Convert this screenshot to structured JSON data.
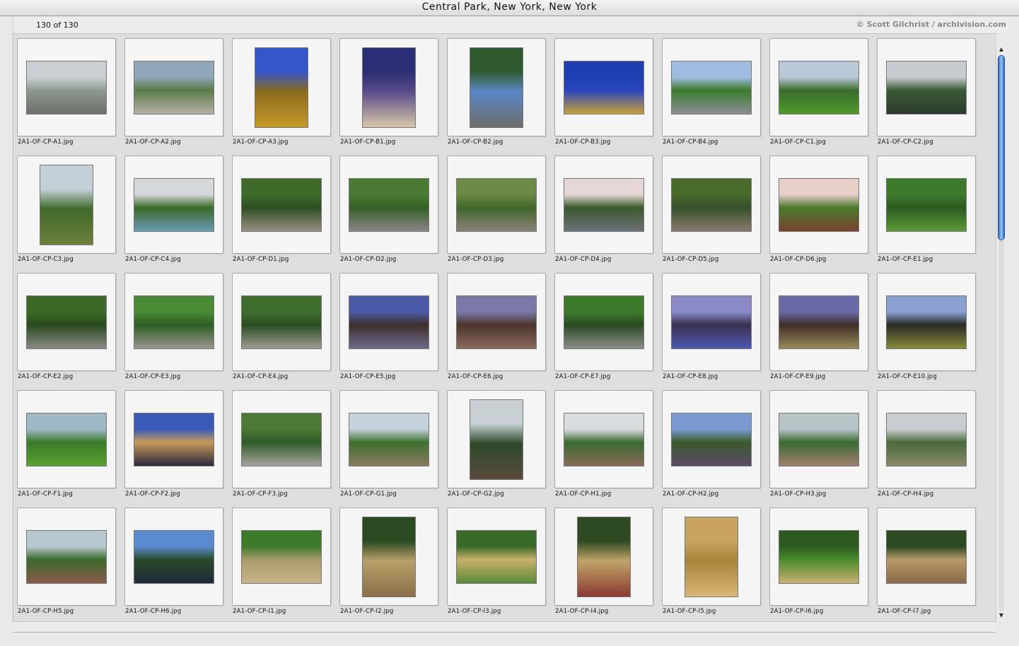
{
  "window": {
    "title": "Central Park, New York, New York"
  },
  "info": {
    "count": "130 of 130",
    "credit": "© Scott Gilchrist / archivision.com"
  },
  "colors": {
    "scroll_accent": "#2f6fc9"
  },
  "slides": [
    {
      "file": "2A1-OF-CP-A1.jpg",
      "orientation": "landscape",
      "palette": [
        "#c9cfd3",
        "#8e9a8f",
        "#6d6f6a"
      ]
    },
    {
      "file": "2A1-OF-CP-A2.jpg",
      "orientation": "landscape",
      "palette": [
        "#8fa7b8",
        "#5a7a4a",
        "#b8b2a6"
      ]
    },
    {
      "file": "2A1-OF-CP-A3.jpg",
      "orientation": "portrait",
      "palette": [
        "#3556c8",
        "#8a6a1c",
        "#c79a2a"
      ]
    },
    {
      "file": "2A1-OF-CP-B1.jpg",
      "orientation": "portrait",
      "palette": [
        "#2a2e74",
        "#5a4a8a",
        "#d8c8a8"
      ]
    },
    {
      "file": "2A1-OF-CP-B2.jpg",
      "orientation": "portrait",
      "palette": [
        "#2f5a2f",
        "#5a87c4",
        "#6d6d6d"
      ]
    },
    {
      "file": "2A1-OF-CP-B3.jpg",
      "orientation": "landscape",
      "palette": [
        "#1f3fb0",
        "#2845c0",
        "#c9a13a"
      ]
    },
    {
      "file": "2A1-OF-CP-B4.jpg",
      "orientation": "landscape",
      "palette": [
        "#9fbde0",
        "#3c7a2c",
        "#8a8f94"
      ]
    },
    {
      "file": "2A1-OF-CP-C1.jpg",
      "orientation": "landscape",
      "palette": [
        "#b9c8d6",
        "#3b6b2b",
        "#4f9a2c"
      ]
    },
    {
      "file": "2A1-OF-CP-C2.jpg",
      "orientation": "landscape",
      "palette": [
        "#c8ccd0",
        "#3a5a34",
        "#2b3a2c"
      ]
    },
    {
      "file": "2A1-OF-CP-C3.jpg",
      "orientation": "portrait",
      "palette": [
        "#c4d0d8",
        "#3f6a2a",
        "#6e7f3a"
      ]
    },
    {
      "file": "2A1-OF-CP-C4.jpg",
      "orientation": "landscape",
      "palette": [
        "#d4d8da",
        "#3a6a2a",
        "#6a9ab0"
      ]
    },
    {
      "file": "2A1-OF-CP-D1.jpg",
      "orientation": "landscape",
      "palette": [
        "#3f6a2a",
        "#2e4e22",
        "#9a8f86"
      ]
    },
    {
      "file": "2A1-OF-CP-D2.jpg",
      "orientation": "landscape",
      "palette": [
        "#4a7a32",
        "#35602a",
        "#8a8482"
      ]
    },
    {
      "file": "2A1-OF-CP-D3.jpg",
      "orientation": "landscape",
      "palette": [
        "#6a8a46",
        "#40682c",
        "#8a8078"
      ]
    },
    {
      "file": "2A1-OF-CP-D4.jpg",
      "orientation": "landscape",
      "palette": [
        "#e6d6d6",
        "#3a5a2c",
        "#6a7078"
      ]
    },
    {
      "file": "2A1-OF-CP-D5.jpg",
      "orientation": "landscape",
      "palette": [
        "#4a6a2c",
        "#36502a",
        "#8a7a6e"
      ]
    },
    {
      "file": "2A1-OF-CP-D6.jpg",
      "orientation": "landscape",
      "palette": [
        "#e8cfc8",
        "#4a7a2c",
        "#7a4030"
      ]
    },
    {
      "file": "2A1-OF-CP-E1.jpg",
      "orientation": "landscape",
      "palette": [
        "#3e7a2c",
        "#2c5a22",
        "#5a9a34"
      ]
    },
    {
      "file": "2A1-OF-CP-E2.jpg",
      "orientation": "landscape",
      "palette": [
        "#3a6a26",
        "#2a4a1e",
        "#8a8a86"
      ]
    },
    {
      "file": "2A1-OF-CP-E3.jpg",
      "orientation": "landscape",
      "palette": [
        "#4a8a34",
        "#2e5e24",
        "#9a968e"
      ]
    },
    {
      "file": "2A1-OF-CP-E4.jpg",
      "orientation": "landscape",
      "palette": [
        "#3e6e2c",
        "#2a4c22",
        "#a09a92"
      ]
    },
    {
      "file": "2A1-OF-CP-E5.jpg",
      "orientation": "landscape",
      "palette": [
        "#4a5aa8",
        "#3e2e2a",
        "#6e6a8e"
      ]
    },
    {
      "file": "2A1-OF-CP-E6.jpg",
      "orientation": "landscape",
      "palette": [
        "#7a7aa8",
        "#4a342a",
        "#8a6a5a"
      ]
    },
    {
      "file": "2A1-OF-CP-E7.jpg",
      "orientation": "landscape",
      "palette": [
        "#3e7a2c",
        "#2a4a22",
        "#8a8e88"
      ]
    },
    {
      "file": "2A1-OF-CP-E8.jpg",
      "orientation": "landscape",
      "palette": [
        "#8a8ac8",
        "#3a3050",
        "#4e58b0"
      ]
    },
    {
      "file": "2A1-OF-CP-E9.jpg",
      "orientation": "landscape",
      "palette": [
        "#6a6aa8",
        "#3e2e26",
        "#9a8a5a"
      ]
    },
    {
      "file": "2A1-OF-CP-E10.jpg",
      "orientation": "landscape",
      "palette": [
        "#8aa0d0",
        "#2a2a26",
        "#8a8a3a"
      ]
    },
    {
      "file": "2A1-OF-CP-F1.jpg",
      "orientation": "landscape",
      "palette": [
        "#9fb8c8",
        "#3a7a2a",
        "#5aa030"
      ]
    },
    {
      "file": "2A1-OF-CP-F2.jpg",
      "orientation": "landscape",
      "palette": [
        "#3a5ab8",
        "#c89a5a",
        "#2a2a3a"
      ]
    },
    {
      "file": "2A1-OF-CP-F3.jpg",
      "orientation": "landscape",
      "palette": [
        "#4a7a34",
        "#2e5a26",
        "#a6a4a0"
      ]
    },
    {
      "file": "2A1-OF-CP-G1.jpg",
      "orientation": "landscape",
      "palette": [
        "#c4d2dc",
        "#3e7030",
        "#8a7a5e"
      ]
    },
    {
      "file": "2A1-OF-CP-G2.jpg",
      "orientation": "portrait",
      "palette": [
        "#c8d0d4",
        "#2e4a2a",
        "#5a4a3e"
      ]
    },
    {
      "file": "2A1-OF-CP-H1.jpg",
      "orientation": "landscape",
      "palette": [
        "#d8dde0",
        "#3a6a30",
        "#8a6a5a"
      ]
    },
    {
      "file": "2A1-OF-CP-H2.jpg",
      "orientation": "landscape",
      "palette": [
        "#7a9ad0",
        "#3a5a2a",
        "#5a4a6a"
      ]
    },
    {
      "file": "2A1-OF-CP-H3.jpg",
      "orientation": "landscape",
      "palette": [
        "#b8c4c8",
        "#3a6a30",
        "#a08070"
      ]
    },
    {
      "file": "2A1-OF-CP-H4.jpg",
      "orientation": "landscape",
      "palette": [
        "#c8ced0",
        "#4a6a3a",
        "#8a8a6a"
      ]
    },
    {
      "file": "2A1-OF-CP-H5.jpg",
      "orientation": "landscape",
      "palette": [
        "#b8c8d0",
        "#3a6a2a",
        "#8a5a4a"
      ]
    },
    {
      "file": "2A1-OF-CP-H6.jpg",
      "orientation": "landscape",
      "palette": [
        "#5a8ad0",
        "#2a4a2a",
        "#1e2a3a"
      ]
    },
    {
      "file": "2A1-OF-CP-I1.jpg",
      "orientation": "landscape",
      "palette": [
        "#3e7a2c",
        "#a89a6a",
        "#c8b48a"
      ]
    },
    {
      "file": "2A1-OF-CP-I2.jpg",
      "orientation": "portrait",
      "palette": [
        "#2a4a22",
        "#b8a06a",
        "#8a7048"
      ]
    },
    {
      "file": "2A1-OF-CP-I3.jpg",
      "orientation": "landscape",
      "palette": [
        "#3a6a2a",
        "#c8b06a",
        "#5a8a3a"
      ]
    },
    {
      "file": "2A1-OF-CP-I4.jpg",
      "orientation": "portrait",
      "palette": [
        "#2e4a22",
        "#c0a46a",
        "#8a3a30"
      ]
    },
    {
      "file": "2A1-OF-CP-I5.jpg",
      "orientation": "portrait",
      "palette": [
        "#c8a460",
        "#a8843a",
        "#d8b878"
      ]
    },
    {
      "file": "2A1-OF-CP-I6.jpg",
      "orientation": "landscape",
      "palette": [
        "#2e5a22",
        "#4a8a2c",
        "#c8b070"
      ]
    },
    {
      "file": "2A1-OF-CP-I7.jpg",
      "orientation": "landscape",
      "palette": [
        "#2a4a22",
        "#b89a6a",
        "#8a6a48"
      ]
    }
  ]
}
